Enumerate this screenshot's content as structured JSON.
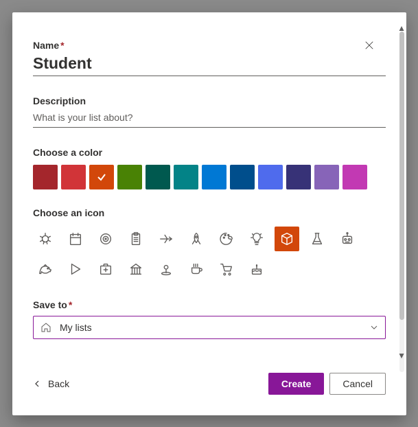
{
  "labels": {
    "name": "Name",
    "description": "Description",
    "choose_color": "Choose a color",
    "choose_icon": "Choose an icon",
    "save_to": "Save to"
  },
  "form": {
    "name_value": "Student",
    "description_value": "",
    "description_placeholder": "What is your list about?",
    "save_to_value": "My lists"
  },
  "colors": [
    {
      "name": "dark-red",
      "hex": "#a4262c"
    },
    {
      "name": "red",
      "hex": "#d13438"
    },
    {
      "name": "orange",
      "hex": "#d2470a",
      "selected": true
    },
    {
      "name": "green",
      "hex": "#498205"
    },
    {
      "name": "dark-teal",
      "hex": "#00594f"
    },
    {
      "name": "teal",
      "hex": "#038387"
    },
    {
      "name": "blue",
      "hex": "#0078d4"
    },
    {
      "name": "dark-blue",
      "hex": "#004e8c"
    },
    {
      "name": "indigo",
      "hex": "#4f6bed"
    },
    {
      "name": "navy",
      "hex": "#373277"
    },
    {
      "name": "purple",
      "hex": "#8764b8"
    },
    {
      "name": "pink",
      "hex": "#c239b3"
    }
  ],
  "icons": [
    {
      "name": "bug"
    },
    {
      "name": "calendar"
    },
    {
      "name": "target"
    },
    {
      "name": "clipboard"
    },
    {
      "name": "airplane"
    },
    {
      "name": "rocket"
    },
    {
      "name": "palette"
    },
    {
      "name": "lightbulb"
    },
    {
      "name": "cube",
      "selected": true
    },
    {
      "name": "flask"
    },
    {
      "name": "robot"
    },
    {
      "name": "piggy-bank"
    },
    {
      "name": "play"
    },
    {
      "name": "first-aid"
    },
    {
      "name": "bank"
    },
    {
      "name": "location-pin"
    },
    {
      "name": "coffee"
    },
    {
      "name": "shopping-cart"
    },
    {
      "name": "cake"
    }
  ],
  "buttons": {
    "back": "Back",
    "create": "Create",
    "cancel": "Cancel"
  }
}
